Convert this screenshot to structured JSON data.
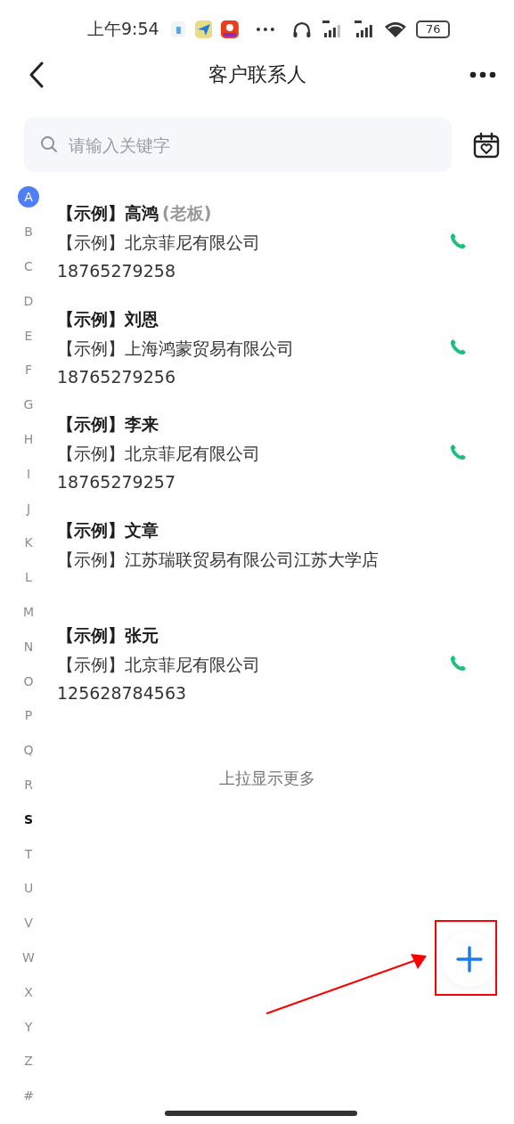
{
  "status_bar": {
    "time": "上午9:54",
    "battery": "76"
  },
  "header": {
    "title": "客户联系人"
  },
  "search": {
    "placeholder": "请输入关键字"
  },
  "index": [
    {
      "letter": "A",
      "selected": true,
      "emphasized": false
    },
    {
      "letter": "B",
      "selected": false,
      "emphasized": false
    },
    {
      "letter": "C",
      "selected": false,
      "emphasized": false
    },
    {
      "letter": "D",
      "selected": false,
      "emphasized": false
    },
    {
      "letter": "E",
      "selected": false,
      "emphasized": false
    },
    {
      "letter": "F",
      "selected": false,
      "emphasized": false
    },
    {
      "letter": "G",
      "selected": false,
      "emphasized": false
    },
    {
      "letter": "H",
      "selected": false,
      "emphasized": false
    },
    {
      "letter": "I",
      "selected": false,
      "emphasized": false
    },
    {
      "letter": "J",
      "selected": false,
      "emphasized": false
    },
    {
      "letter": "K",
      "selected": false,
      "emphasized": false
    },
    {
      "letter": "L",
      "selected": false,
      "emphasized": false
    },
    {
      "letter": "M",
      "selected": false,
      "emphasized": false
    },
    {
      "letter": "N",
      "selected": false,
      "emphasized": false
    },
    {
      "letter": "O",
      "selected": false,
      "emphasized": false
    },
    {
      "letter": "P",
      "selected": false,
      "emphasized": false
    },
    {
      "letter": "Q",
      "selected": false,
      "emphasized": false
    },
    {
      "letter": "R",
      "selected": false,
      "emphasized": false
    },
    {
      "letter": "S",
      "selected": false,
      "emphasized": true
    },
    {
      "letter": "T",
      "selected": false,
      "emphasized": false
    },
    {
      "letter": "U",
      "selected": false,
      "emphasized": false
    },
    {
      "letter": "V",
      "selected": false,
      "emphasized": false
    },
    {
      "letter": "W",
      "selected": false,
      "emphasized": false
    },
    {
      "letter": "X",
      "selected": false,
      "emphasized": false
    },
    {
      "letter": "Y",
      "selected": false,
      "emphasized": false
    },
    {
      "letter": "Z",
      "selected": false,
      "emphasized": false
    },
    {
      "letter": "#",
      "selected": false,
      "emphasized": false
    }
  ],
  "contacts": [
    {
      "name": "【示例】高鸿",
      "role": "(老板)",
      "company": "【示例】北京菲尼有限公司",
      "phone": "18765279258",
      "callable": true
    },
    {
      "name": "【示例】刘恩",
      "company": "【示例】上海鸿蒙贸易有限公司",
      "phone": "18765279256",
      "callable": true
    },
    {
      "name": "【示例】李来",
      "company": "【示例】北京菲尼有限公司",
      "phone": "18765279257",
      "callable": true
    },
    {
      "name": "【示例】文章",
      "company": "【示例】江苏瑞联贸易有限公司江苏大学店",
      "callable": false
    },
    {
      "name": "【示例】张元",
      "company": "【示例】北京菲尼有限公司",
      "phone": "125628784563",
      "callable": true
    }
  ],
  "load_more": "上拉显示更多"
}
